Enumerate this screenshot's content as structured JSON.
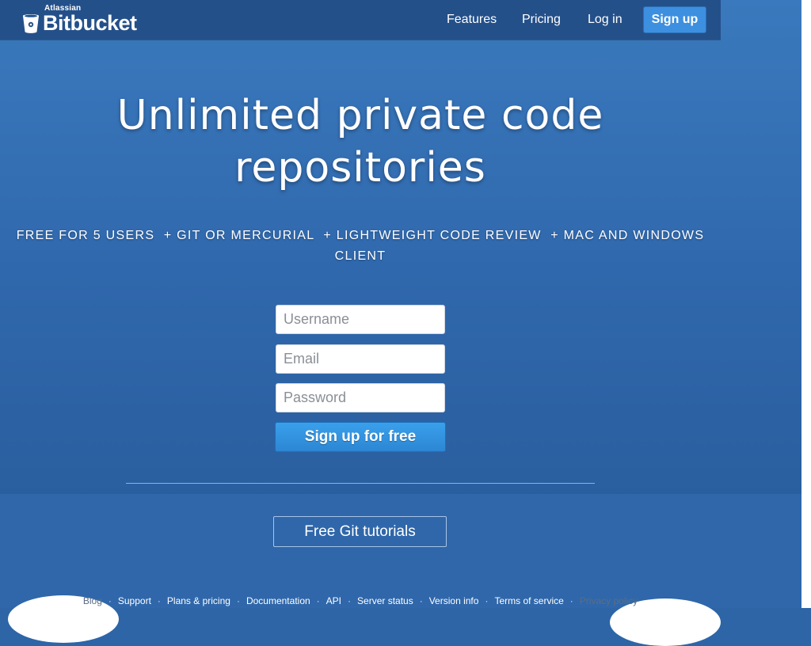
{
  "brand": {
    "parent": "Atlassian",
    "name": "Bitbucket"
  },
  "nav": {
    "items": [
      "Features",
      "Pricing",
      "Log in"
    ],
    "signup_label": "Sign up"
  },
  "hero": {
    "headline_line1": "Unlimited private code",
    "headline_line2": "repositories",
    "features_line1": "FREE FOR 5 USERS  + GIT OR MERCURIAL  + LIGHTWEIGHT CODE REVIEW  + MAC AND WINDOWS",
    "features_line2": "CLIENT"
  },
  "form": {
    "username_placeholder": "Username",
    "email_placeholder": "Email",
    "password_placeholder": "Password",
    "submit_label": "Sign up for free"
  },
  "tutorials_label": "Free Git tutorials",
  "footer": {
    "links": [
      "Blog",
      "Support",
      "Plans & pricing",
      "Documentation",
      "API",
      "Server status",
      "Version info",
      "Terms of service",
      "Privacy policy"
    ],
    "separator": "·"
  },
  "colors": {
    "hero_top": "#3a79bd",
    "topbar": "#24508a",
    "cta": "#3aa0ec"
  },
  "icons": [
    "bitbucket-logo-icon"
  ]
}
